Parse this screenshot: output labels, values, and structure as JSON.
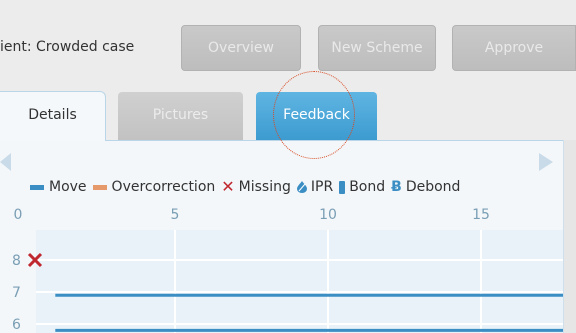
{
  "header": {
    "patient_label": "ient: Crowded case",
    "buttons": {
      "overview": "Overview",
      "new_scheme": "New Scheme",
      "approve": "Approve"
    }
  },
  "tabs": {
    "details": "Details",
    "pictures": "Pictures",
    "feedback": "Feedback"
  },
  "legend": {
    "move": "Move",
    "overcorrection": "Overcorrection",
    "missing": "Missing",
    "ipr": "IPR",
    "bond": "Bond",
    "debond": "Debond"
  },
  "chart_data": {
    "type": "line",
    "x_ticks": [
      "0",
      "5",
      "10",
      "15"
    ],
    "x_tick_values": [
      0,
      5,
      10,
      15
    ],
    "y_ticks": [
      "8",
      "7",
      "6"
    ],
    "y_tick_values": [
      8,
      7,
      6
    ],
    "xlim": [
      0,
      17
    ],
    "ylim": [
      5.7,
      8.8
    ],
    "grid": true,
    "series": [
      {
        "label": "Move",
        "y": 6.9,
        "x_start": 0.5,
        "x_end": 17
      },
      {
        "label": "Move",
        "y": 5.8,
        "x_start": 0.5,
        "x_end": 17
      }
    ],
    "markers": [
      {
        "label": "Missing",
        "x": 0.1,
        "y": 8
      }
    ]
  },
  "colors": {
    "accent": "#3d9bd0",
    "move": "#3b8ec4",
    "overcorrection": "#e69a6c",
    "missing": "#c0282f",
    "grid": "#ffffff",
    "plot_bg": "#e9f2f8"
  }
}
